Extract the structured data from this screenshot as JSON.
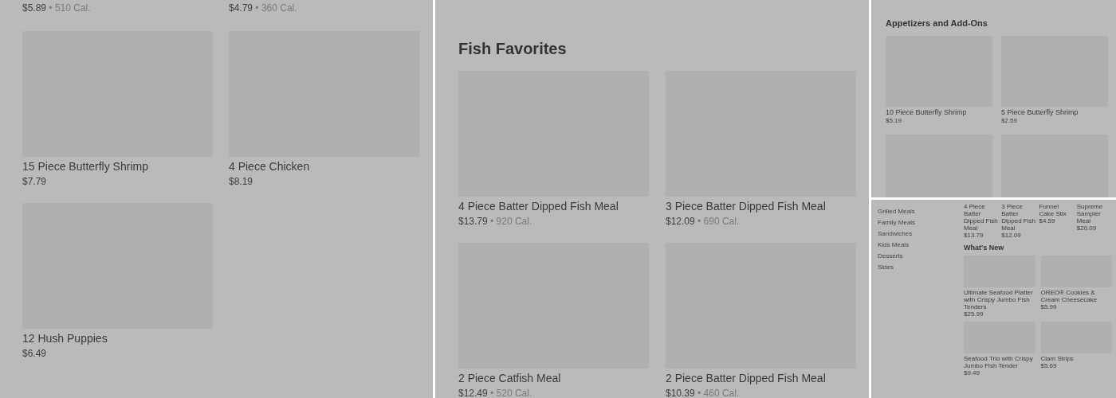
{
  "left_panel": {
    "top_prices": [
      {
        "price": "$5.89",
        "separator": "•",
        "calories": "510 Cal."
      },
      {
        "price": "$4.79",
        "separator": "•",
        "calories": "360 Cal."
      }
    ],
    "items": [
      {
        "kind": "dish",
        "name": "15 Piece Butterfly Shrimp",
        "price": "$7.79"
      },
      {
        "kind": "dish",
        "name": "4 Piece Chicken",
        "price": "$8.19"
      },
      {
        "kind": "dish",
        "name": "12 Hush Puppies",
        "price": "$6.49"
      }
    ]
  },
  "middle_panel": {
    "heading": "Fish Favorites",
    "items": [
      {
        "kind": "dish",
        "name": "4 Piece Batter Dipped Fish Meal",
        "price": "$13.79",
        "separator": "•",
        "calories": "920 Cal."
      },
      {
        "kind": "dish",
        "name": "3 Piece Batter Dipped Fish Meal",
        "price": "$12.09",
        "separator": "•",
        "calories": "690 Cal."
      },
      {
        "kind": "dish",
        "name": "2 Piece Catfish Meal",
        "price": "$12.49",
        "separator": "•",
        "calories": "520 Cal."
      },
      {
        "kind": "dish",
        "name": "2 Piece Batter Dipped Fish Meal",
        "price": "$10.39",
        "separator": "•",
        "calories": "460 Cal."
      }
    ]
  },
  "right_top_panel": {
    "heading": "Appetizers and Add-Ons",
    "items": [
      {
        "kind": "dish",
        "name": "10 Piece Butterfly Shrimp",
        "price": "$5.19"
      },
      {
        "kind": "dish",
        "name": "5 Piece Butterfly Shrimp",
        "price": "$2.59"
      },
      {
        "kind": "image_only"
      },
      {
        "kind": "image_only"
      }
    ]
  },
  "right_bottom_panel": {
    "categories": [
      "Grilled Meals",
      "Family Meals",
      "Sandwiches",
      "Kids Meals",
      "Desserts",
      "Sides"
    ],
    "strip": [
      {
        "name": "4 Piece Batter Dipped Fish Meal",
        "price": "$13.79"
      },
      {
        "name": "3 Piece Batter Dipped Fish Meal",
        "price": "$12.09"
      },
      {
        "name": "Funnel Cake Stix",
        "price": "$4.59"
      },
      {
        "name": "Supreme Sampler Meal",
        "price": "$20.09"
      }
    ],
    "heading": "What's New",
    "items": [
      {
        "kind": "dish",
        "name": "Ultimate Seafood Platter with Crispy Jumbo Fish Tenders",
        "price": "$25.99"
      },
      {
        "kind": "dish",
        "name": "OREO® Cookies & Cream Cheesecake",
        "price": "$5.99"
      },
      {
        "kind": "dish",
        "name": "Seafood Trio with Crispy Jumbo Fish Tender",
        "price": "$9.49"
      },
      {
        "kind": "dish",
        "name": "Clam Strips",
        "price": "$5.69"
      }
    ]
  }
}
